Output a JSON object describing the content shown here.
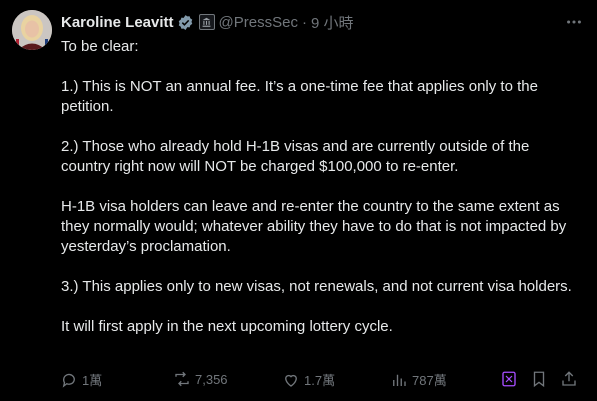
{
  "tweet": {
    "author_name": "Karoline Leavitt",
    "handle": "@PressSec",
    "separator": "·",
    "time": "9 小時",
    "paragraphs": [
      "To be clear:",
      "1.) This is NOT an annual fee. It’s a one-time fee that applies only to the petition.",
      "2.) Those who already hold H-1B visas and are currently outside of the country right now will NOT be charged $100,000 to re-enter.",
      "H-1B visa holders can leave and re-enter the country to the same extent as they normally would; whatever ability they have to do that is not impacted by yesterday’s proclamation.",
      "3.) This applies only to new visas, not renewals, and not current visa holders.",
      "It will first apply in the next upcoming lottery cycle."
    ]
  },
  "actions": {
    "replies": "1萬",
    "reposts": "7,356",
    "likes": "1.7萬",
    "views": "787萬"
  },
  "icons": {
    "verified": "verified-check-icon",
    "gov_badge": "government-badge-icon",
    "more": "more-options-icon",
    "reply": "reply-icon",
    "repost": "repost-icon",
    "like": "heart-icon",
    "views": "views-chart-icon",
    "grok": "grok-icon",
    "bookmark": "bookmark-icon",
    "share": "share-icon"
  },
  "colors": {
    "background": "#000000",
    "text": "#e7e9ea",
    "secondary": "#71767b",
    "verified": "#829aab",
    "grok_accent": "#a64dff"
  }
}
